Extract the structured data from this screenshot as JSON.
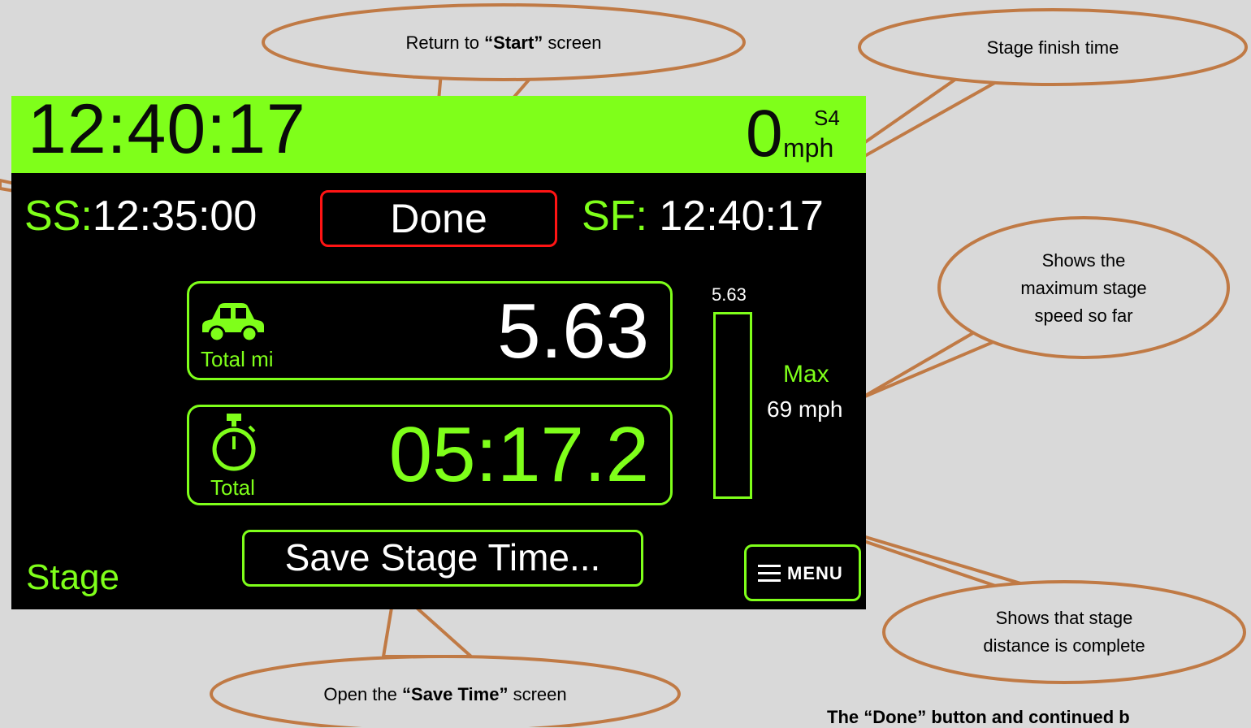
{
  "device": {
    "clock": "12:40:17",
    "speed": "0",
    "speed_unit": "mph",
    "stage_number": "S4",
    "ss_label": "SS:",
    "ss_time": "12:35:00",
    "done_label": "Done",
    "sf_label": "SF:",
    "sf_time": "12:40:17",
    "distance_value": "5.63",
    "distance_label": "Total mi",
    "elapsed_value": "05:17.2",
    "elapsed_label": "Total",
    "bar_top_value": "5.63",
    "stage_progress_fraction": 1.0,
    "max_label": "Max",
    "max_value": "69 mph",
    "mode_label": "Stage",
    "save_button_label": "Save Stage Time...",
    "menu_label": "MENU",
    "colors": {
      "accent": "#7fff1a",
      "done_border": "#ff1414",
      "screen_bg": "#000000"
    }
  },
  "callouts": {
    "done": {
      "pre": "Return to ",
      "bold": "“Start”",
      "post": " screen"
    },
    "finish": {
      "text": "Stage finish time"
    },
    "max": {
      "line1": "Shows the",
      "line2": "maximum stage",
      "line3": "speed so far"
    },
    "bar": {
      "line1": "Shows that stage",
      "line2": "distance is complete"
    },
    "save": {
      "pre": "Open the ",
      "bold": "“Save Time”",
      "post": " screen"
    }
  },
  "bottom_note": "The “Done” button and continued b"
}
